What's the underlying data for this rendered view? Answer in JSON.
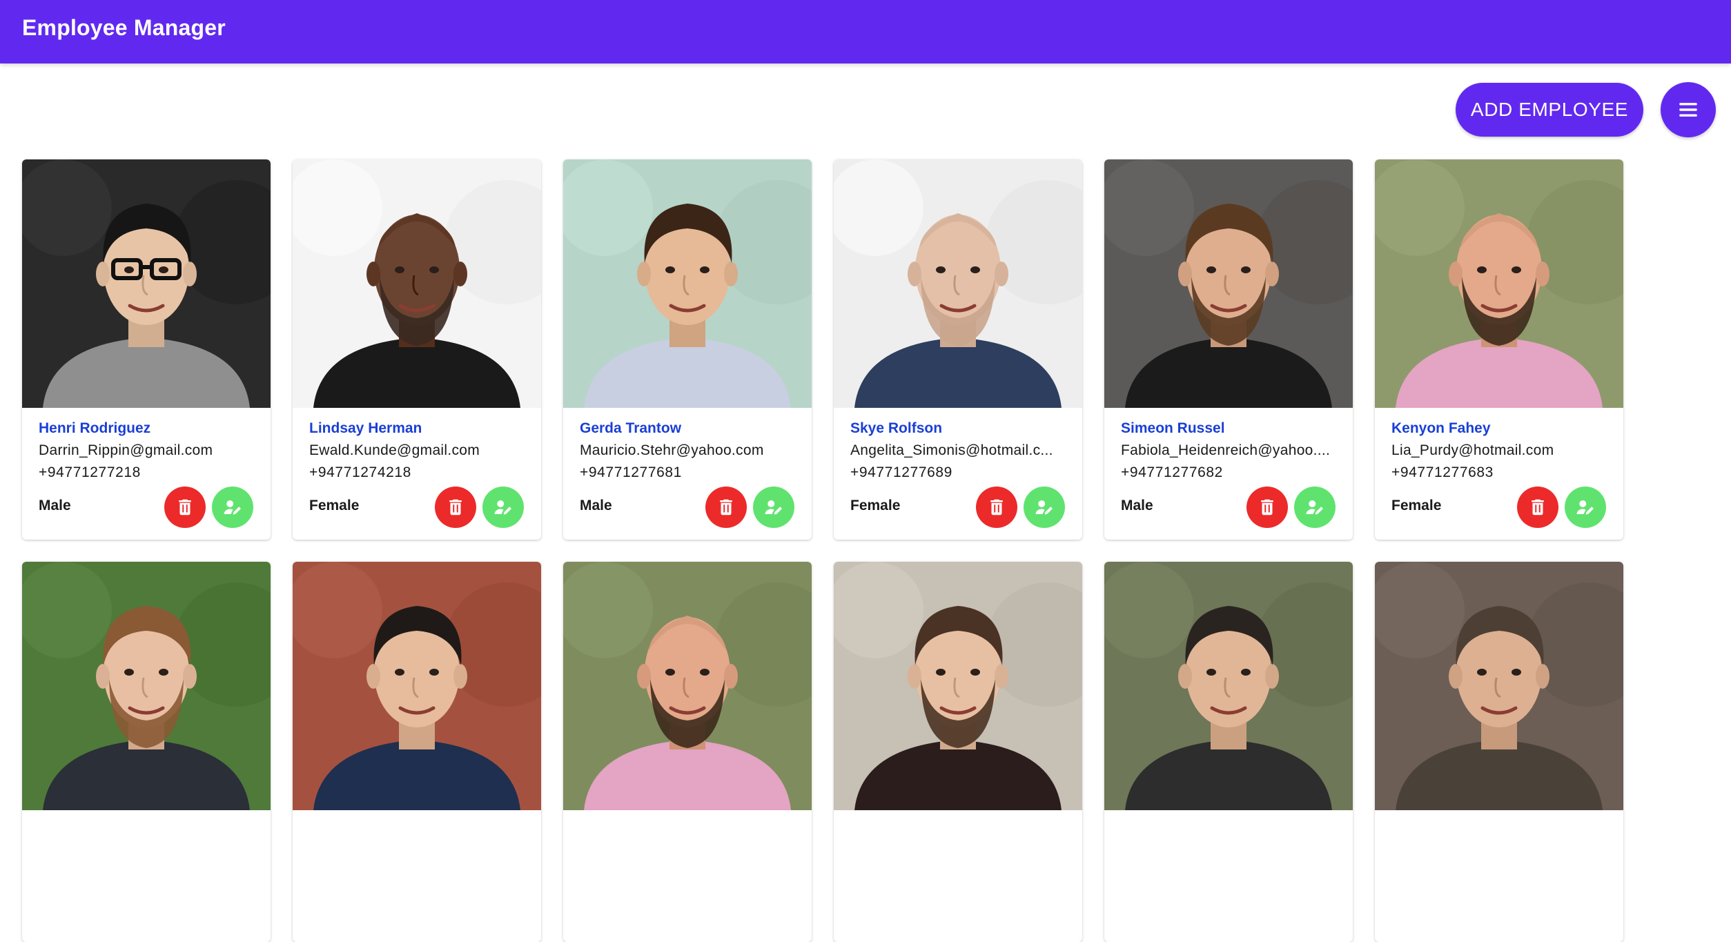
{
  "app": {
    "title": "Employee Manager"
  },
  "toolbar": {
    "add_label": "ADD EMPLOYEE",
    "menu_icon": "hamburger-menu-icon"
  },
  "colors": {
    "primary": "#6129f0",
    "delete": "#ec2a2a",
    "edit": "#5fe36e",
    "name_link": "#1a3fd6"
  },
  "employees": [
    {
      "name": "Henri Rodriguez",
      "email": "Darrin_Rippin@gmail.com",
      "phone": "+94771277218",
      "gender": "Male",
      "photo": {
        "bg": "#2a2a2a",
        "skin": "#e8c4a6",
        "hair": "#161616",
        "shirt": "#8f8f8f",
        "glasses": true,
        "beard": false,
        "bald": false
      }
    },
    {
      "name": "Lindsay Herman",
      "email": "Ewald.Kunde@gmail.com",
      "phone": "+94771274218",
      "gender": "Female",
      "photo": {
        "bg": "#f4f4f4",
        "skin": "#6b4431",
        "hair": "#3a2a22",
        "shirt": "#1a1a1a",
        "glasses": false,
        "beard": true,
        "bald": true
      }
    },
    {
      "name": "Gerda Trantow",
      "email": "Mauricio.Stehr@yahoo.com",
      "phone": "+94771277681",
      "gender": "Male",
      "photo": {
        "bg": "#b7d4c9",
        "skin": "#e6b997",
        "hair": "#3b2516",
        "shirt": "#c7cfe0",
        "glasses": false,
        "beard": false,
        "bald": false
      }
    },
    {
      "name": "Skye Rolfson",
      "email": "Angelita_Simonis@hotmail.c...",
      "phone": "+94771277689",
      "gender": "Female",
      "photo": {
        "bg": "#eeeeee",
        "skin": "#e4c0a8",
        "hair": "#c9a58d",
        "shirt": "#2d3e5e",
        "glasses": false,
        "beard": true,
        "bald": true
      }
    },
    {
      "name": "Simeon Russel",
      "email": "Fabiola_Heidenreich@yahoo....",
      "phone": "+94771277682",
      "gender": "Male",
      "photo": {
        "bg": "#5c5a58",
        "skin": "#dfae8f",
        "hair": "#5a3b22",
        "shirt": "#1b1b1b",
        "glasses": false,
        "beard": true,
        "bald": false
      }
    },
    {
      "name": "Kenyon Fahey",
      "email": "Lia_Purdy@hotmail.com",
      "phone": "+94771277683",
      "gender": "Female",
      "photo": {
        "bg": "#8e9a6c",
        "skin": "#e3a98a",
        "hair": "#3d2a1c",
        "shirt": "#e4a4c3",
        "glasses": false,
        "beard": true,
        "bald": true
      }
    },
    {
      "photo": {
        "bg": "#4f7a3a",
        "skin": "#e8bfa2",
        "hair": "#8a5a34",
        "shirt": "#2b2f37",
        "glasses": false,
        "beard": true,
        "bald": false
      }
    },
    {
      "photo": {
        "bg": "#a4523f",
        "skin": "#e6bc9c",
        "hair": "#1f1a17",
        "shirt": "#1f2f4f",
        "glasses": false,
        "beard": false,
        "bald": false
      }
    },
    {
      "photo": {
        "bg": "#7f8d5e",
        "skin": "#e3a98a",
        "hair": "#3d2a1c",
        "shirt": "#e4a4c3",
        "glasses": false,
        "beard": true,
        "bald": true
      }
    },
    {
      "photo": {
        "bg": "#c7c0b4",
        "skin": "#e7c0a4",
        "hair": "#4a3324",
        "shirt": "#2a1d1c",
        "glasses": false,
        "beard": true,
        "bald": false
      }
    },
    {
      "photo": {
        "bg": "#6e7757",
        "skin": "#e1b696",
        "hair": "#2a2420",
        "shirt": "#2d2d2d",
        "glasses": false,
        "beard": false,
        "bald": false
      }
    },
    {
      "photo": {
        "bg": "#6c5e55",
        "skin": "#dcb091",
        "hair": "#4d3f34",
        "shirt": "#4a4238",
        "glasses": false,
        "beard": false,
        "bald": false
      }
    }
  ]
}
